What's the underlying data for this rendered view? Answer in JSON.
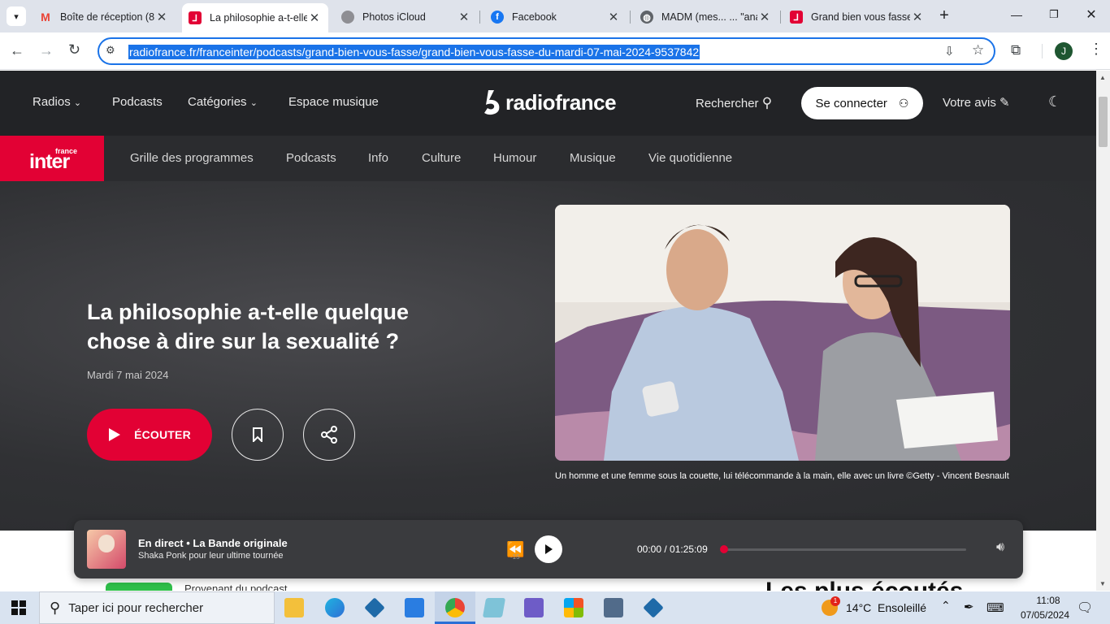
{
  "browser": {
    "tabs": [
      {
        "title": "Boîte de réception (8",
        "icon": "gmail-icon",
        "color": "#ea4335"
      },
      {
        "title": "La philosophie a-t-elle",
        "icon": "radiofrance-icon",
        "color": "#e20134",
        "active": true
      },
      {
        "title": "Photos iCloud",
        "icon": "apple-icon",
        "color": "#777777"
      },
      {
        "title": "Facebook",
        "icon": "facebook-icon",
        "color": "#1877f2"
      },
      {
        "title": "MADM (mes... ... \"ana",
        "icon": "globe-icon",
        "color": "#5f6368"
      },
      {
        "title": "Grand bien vous fasse",
        "icon": "radiofrance-icon",
        "color": "#e20134"
      }
    ],
    "url": "radiofrance.fr/franceinter/podcasts/grand-bien-vous-fasse/grand-bien-vous-fasse-du-mardi-07-mai-2024-9537842",
    "profile_initial": "J"
  },
  "site": {
    "nav": {
      "radios": "Radios",
      "podcasts": "Podcasts",
      "categories": "Catégories",
      "music": "Espace musique"
    },
    "logo": "radiofrance",
    "search": "Rechercher",
    "login": "Se connecter",
    "feedback": "Votre avis",
    "inter_small": "france",
    "inter_big": "inter",
    "subnav": [
      "Grille des programmes",
      "Podcasts",
      "Info",
      "Culture",
      "Humour",
      "Musique",
      "Vie quotidienne"
    ]
  },
  "episode": {
    "title": "La philosophie a-t-elle quelque chose à dire sur la sexualité ?",
    "date": "Mardi 7 mai 2024",
    "listen": "ÉCOUTER",
    "caption": "Un homme et une femme sous la couette, lui télécommande à la main, elle avec un livre ©Getty - Vincent Besnault"
  },
  "below": {
    "podcast_from": "Provenant du podcast",
    "most_listened": "Les plus écoutés"
  },
  "player": {
    "live": "En direct",
    "show": "La Bande originale",
    "subtitle": "Shaka Ponk pour leur ultime tournée",
    "skip": "-15",
    "time": "00:00 / 01:25:09",
    "progress": 0
  },
  "taskbar": {
    "search": "Taper ici pour rechercher",
    "weather": "14°C  Ensoleillé",
    "badge": "1",
    "time": "11:08",
    "date": "07/05/2024"
  }
}
